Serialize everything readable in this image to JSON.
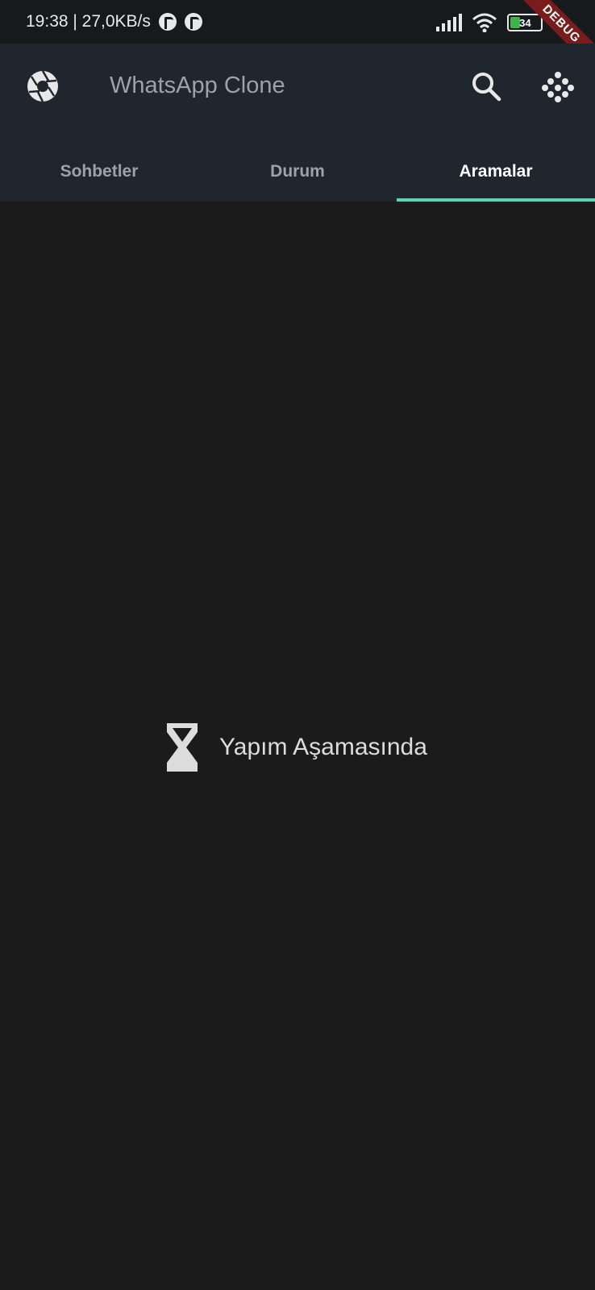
{
  "status_bar": {
    "time_speed": "19:38 | 27,0KB/s",
    "battery_level": "34",
    "debug_label": "DEBUG"
  },
  "app_bar": {
    "title": "WhatsApp Clone",
    "icons": [
      "camera-icon",
      "search-icon",
      "menu-icon"
    ]
  },
  "tabs": [
    {
      "label": "Sohbetler",
      "active": false
    },
    {
      "label": "Durum",
      "active": false
    },
    {
      "label": "Aramalar",
      "active": true
    }
  ],
  "content": {
    "message": "Yapım Aşamasında",
    "icon": "hourglass-icon"
  },
  "colors": {
    "app_bar": "#1f262d",
    "background": "#1b1b1b",
    "tab_indicator": "#5bd5b3",
    "battery_fill": "#3db54a",
    "debug_ribbon": "#7b1c1c"
  }
}
